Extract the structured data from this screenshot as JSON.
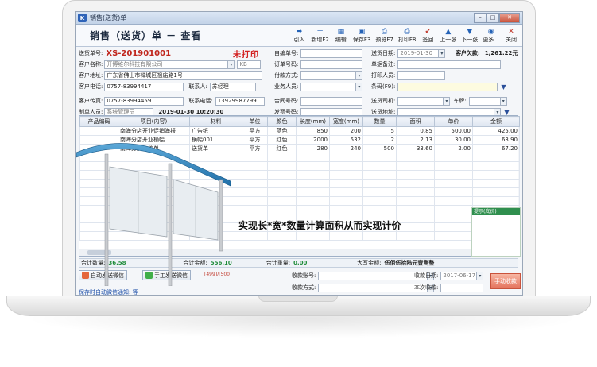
{
  "window": {
    "title": "销售(送货)单",
    "app_icon": "K"
  },
  "header": {
    "form_title": "销售（送货）单 － 查看"
  },
  "toolbar": {
    "buttons": [
      {
        "label": "引入",
        "icon": "import-icon",
        "glyph": "➡"
      },
      {
        "label": "新增F2",
        "icon": "add-icon",
        "glyph": "＋"
      },
      {
        "label": "编辑",
        "icon": "edit-icon",
        "glyph": "▦"
      },
      {
        "label": "保存F3",
        "icon": "save-icon",
        "glyph": "▣"
      },
      {
        "label": "预览F7",
        "icon": "preview-icon",
        "glyph": "⎙"
      },
      {
        "label": "打印F8",
        "icon": "print-icon",
        "glyph": "⎙"
      },
      {
        "label": "签回",
        "icon": "check-icon",
        "glyph": "✔"
      },
      {
        "label": "上一张",
        "icon": "arrow-up-icon",
        "glyph": "▲"
      },
      {
        "label": "下一张",
        "icon": "arrow-down-icon",
        "glyph": "▼"
      },
      {
        "label": "更多...",
        "icon": "more-icon",
        "glyph": "◉"
      },
      {
        "label": "关闭",
        "icon": "close-icon",
        "glyph": "✕"
      }
    ]
  },
  "form": {
    "order_no_label": "送货单号:",
    "order_no": "XS-201901001",
    "status": "未打印",
    "self_no_label": "自编单号:",
    "self_no": "",
    "delivery_date_label": "送货日期:",
    "delivery_date": "2019-01-30",
    "arrears_label": "客户欠款:",
    "arrears": "1,261.22元",
    "customer_name_label": "客户名称:",
    "customer_name": "开博维尔科技有限公司",
    "customer_code": "KB",
    "order_label": "订单号码:",
    "order": "",
    "remark_label": "单据备注:",
    "remark": "",
    "address_label": "客户地址:",
    "address": "广东省佛山市禅城区祖庙路1号",
    "payment_label": "付款方式:",
    "payment": "",
    "printer_label": "打印人员:",
    "printer": "",
    "phone_label": "客户电话:",
    "phone": "0757-83994417",
    "contact_label": "联系人:",
    "contact": "苏经理",
    "sales_label": "业务人员:",
    "sales": "",
    "barcode_label": "条码(F9):",
    "barcode": "",
    "fax_label": "客户传真:",
    "fax": "0757-83994459",
    "contact_phone_label": "联系电话:",
    "contact_phone": "13929987799",
    "contract_label": "合同号码:",
    "contract": "",
    "driver_label": "送货司机:",
    "driver": "",
    "vehicle_label": "车牌:",
    "vehicle": "",
    "creator_label": "制单人员:",
    "creator": "系统管理员",
    "created_at": "2019-01-30 10:20:30",
    "invoice_label": "发票号码:",
    "invoice": "",
    "delivery_addr_label": "送货地址:",
    "delivery_addr": ""
  },
  "grid": {
    "columns": [
      "产品编码",
      "项目(内容)",
      "材料",
      "单位",
      "颜色",
      "长度(mm)",
      "宽度(mm)",
      "数量",
      "面积",
      "单价",
      "金额"
    ],
    "rows": [
      [
        "",
        "南海分店开业促销海报",
        "广告纸",
        "平方",
        "蓝色",
        "850",
        "200",
        "5",
        "0.85",
        "500.00",
        "425.00"
      ],
      [
        "",
        "南海分店开业横幅",
        "横幅001",
        "平方",
        "红色",
        "2000",
        "532",
        "2",
        "2.13",
        "30.00",
        "63.90"
      ],
      [
        "",
        "南海分店宣传单",
        "送货单",
        "平方",
        "红色",
        "280",
        "240",
        "500",
        "33.60",
        "2.00",
        "67.20"
      ]
    ]
  },
  "side_panel": {
    "title": "提示(底价)"
  },
  "caption": "实现长*宽*数量计算面积从而实现计价",
  "totals": {
    "qty_label": "合计数量:",
    "qty": "36.58",
    "amount_label": "合计金额:",
    "amount": "556.10",
    "weight_label": "合计重量:",
    "weight": "0.00",
    "upper_label": "大写金额:",
    "upper": "伍佰伍拾陆元壹角整"
  },
  "bottom": {
    "auto_wechat_label": "自动发送微信",
    "manual_wechat_label": "手工发送微信",
    "counter": "[499]/[500]",
    "hint": "保存时自动微信通知: 等",
    "account_label": "收款账号:",
    "account": "",
    "receipt_date_label": "收款日期:",
    "receipt_date": "2017-06-17",
    "method_label": "收款方式:",
    "method": "",
    "this_receipt_label": "本次收款:",
    "this_receipt": "",
    "receive_button": "手动收款"
  },
  "window_controls": [
    "minimize",
    "maximize",
    "close"
  ]
}
